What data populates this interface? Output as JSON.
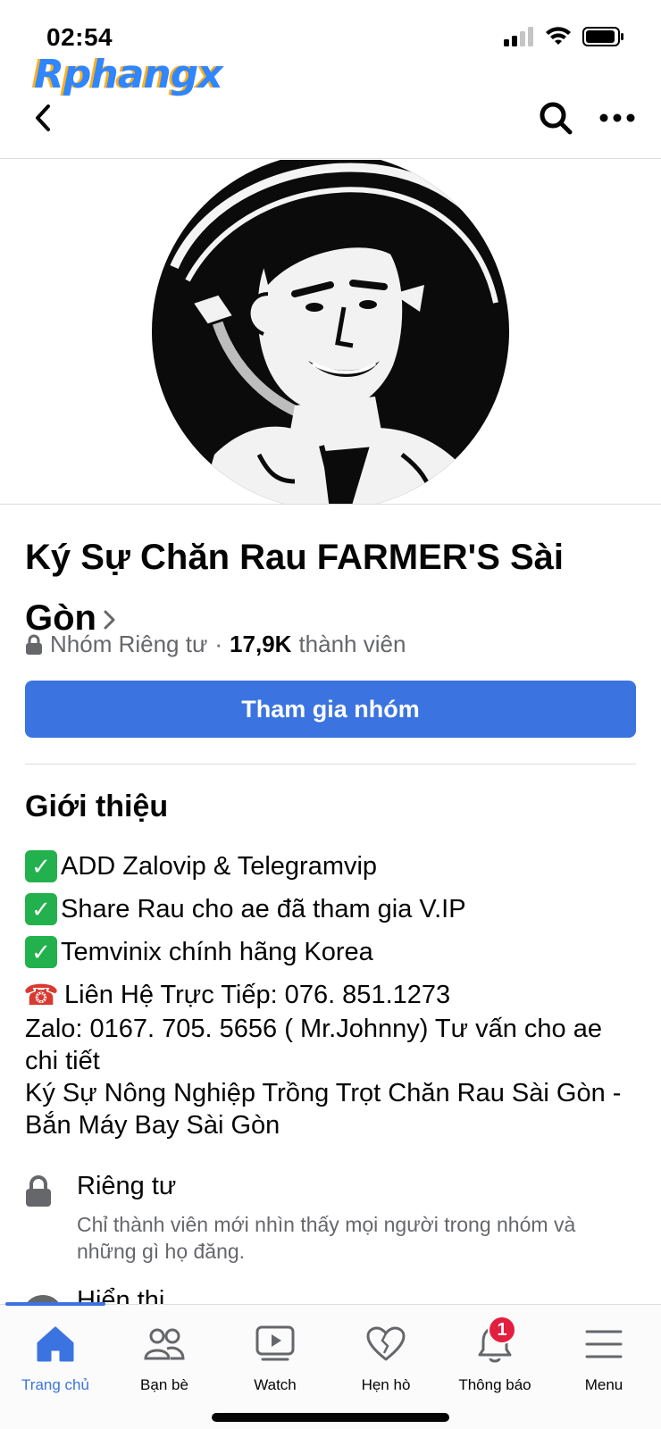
{
  "status": {
    "time": "02:54"
  },
  "watermark": {
    "text": "Rphangx"
  },
  "group": {
    "name": "Ký Sự Chăn Rau FARMER'S Sài Gòn",
    "privacy_label": "Nhóm Riêng tư",
    "separator": "·",
    "member_count": "17,9K",
    "member_label": "thành viên",
    "join_label": "Tham gia nhóm"
  },
  "about": {
    "title": "Giới thiệu",
    "lines": [
      "ADD Zalovip & Telegramvip",
      "Share Rau cho ae đã tham gia V.IP",
      "Temvinix chính hãng Korea"
    ],
    "phone_line": "Liên Hệ Trực Tiếp: 076. 851.1273",
    "zalo_line": "Zalo: 0167. 705. 5656 ( Mr.Johnny) Tư vấn cho ae chi tiết",
    "desc_line": "Ký Sự Nông Nghiệp Trồng Trọt Chăn Rau Sài Gòn - Bắn  Máy Bay Sài Gòn"
  },
  "privacy": {
    "title": "Riêng tư",
    "desc": "Chỉ thành viên mới nhìn thấy mọi người trong nhóm và những gì họ đăng."
  },
  "visibility": {
    "title": "Hiển thị"
  },
  "tabs": [
    {
      "label": "Trang chủ",
      "icon": "home-icon",
      "active": true
    },
    {
      "label": "Bạn bè",
      "icon": "friends-icon"
    },
    {
      "label": "Watch",
      "icon": "watch-icon"
    },
    {
      "label": "Hẹn hò",
      "icon": "dating-heart-icon"
    },
    {
      "label": "Thông báo",
      "icon": "bell-icon",
      "badge": "1"
    },
    {
      "label": "Menu",
      "icon": "menu-icon"
    }
  ],
  "colors": {
    "accent": "#3b74e0",
    "badge": "#e41e3f",
    "muted": "#65676b"
  }
}
